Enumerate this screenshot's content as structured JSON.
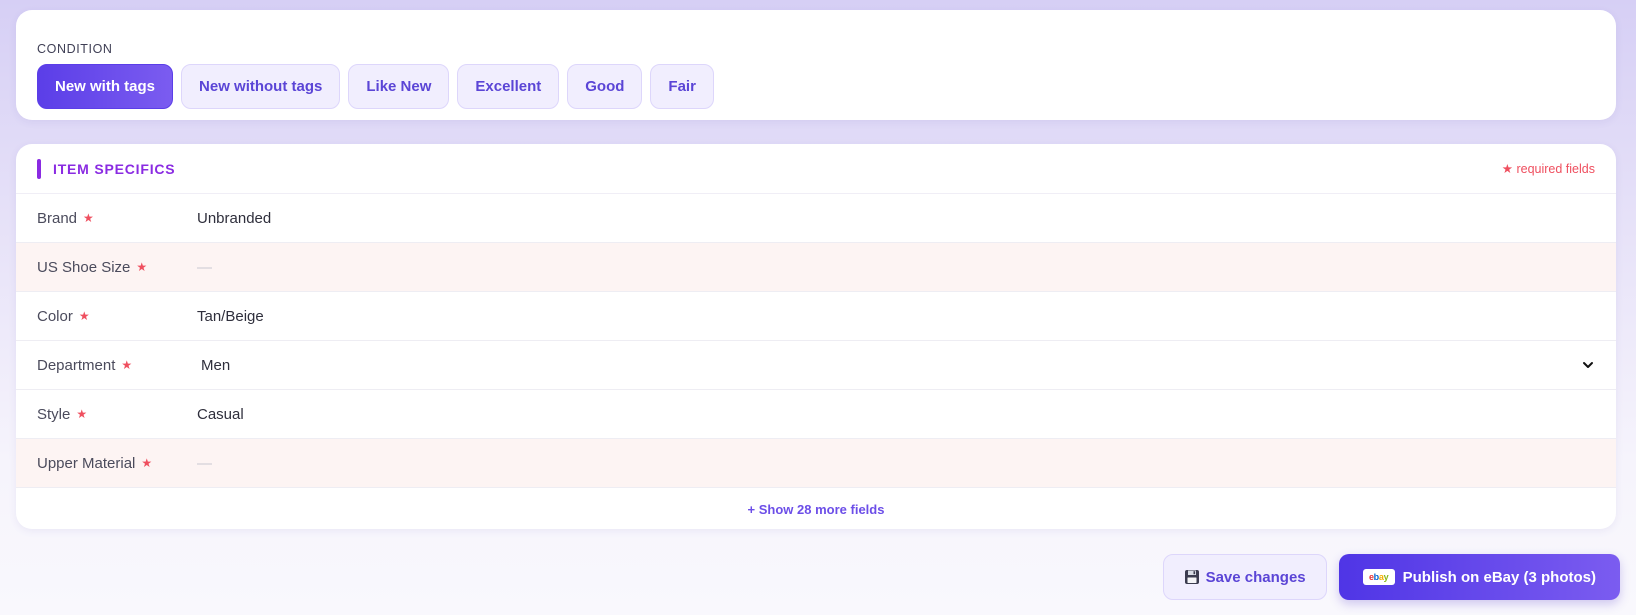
{
  "condition": {
    "label": "CONDITION",
    "options": [
      "New with tags",
      "New without tags",
      "Like New",
      "Excellent",
      "Good",
      "Fair"
    ],
    "selected": "New with tags"
  },
  "item_specifics": {
    "title": "ITEM SPECIFICS",
    "required_note": "★ required fields",
    "required_star": "★",
    "empty_placeholder": "—",
    "rows": [
      {
        "label": "Brand",
        "value": "Unbranded"
      },
      {
        "label": "US Shoe Size",
        "value": "—"
      },
      {
        "label": "Color",
        "value": "Tan/Beige"
      },
      {
        "label": "Department",
        "value": "Men"
      },
      {
        "label": "Style",
        "value": "Casual"
      },
      {
        "label": "Upper Material",
        "value": "—"
      }
    ],
    "show_more": "+ Show 28 more fields"
  },
  "actions": {
    "save_label": "Save changes",
    "publish_label": "Publish on eBay (3 photos)",
    "ebay_logo": [
      "e",
      "b",
      "a",
      "y"
    ]
  },
  "colors": {
    "accent": "#5b3ee8",
    "section_title": "#8a2be2",
    "required": "#ef4f5f"
  }
}
